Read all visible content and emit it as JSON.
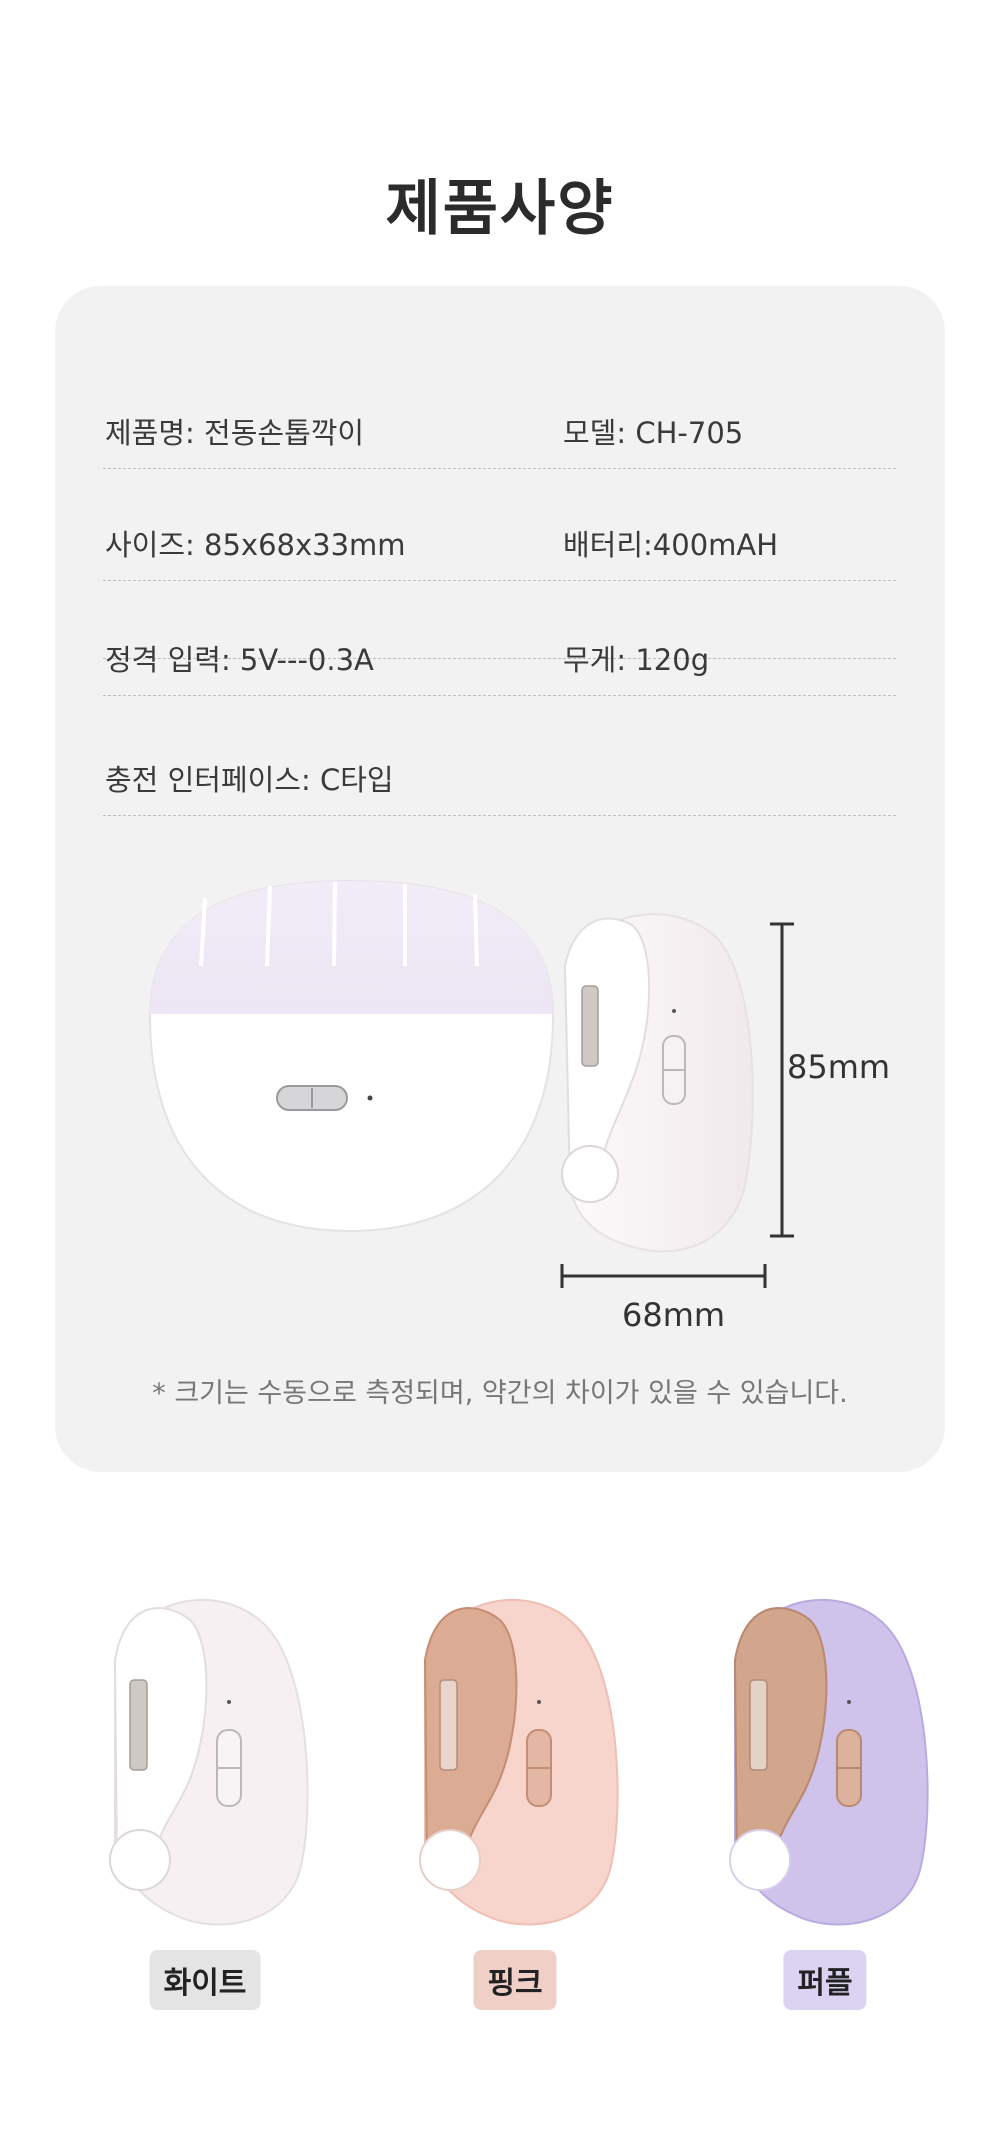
{
  "title": "제품사양",
  "specs": [
    {
      "left": "제품명: 전동손톱깍이",
      "right": "모델: CH-705"
    },
    {
      "left": "사이즈: 85x68x33mm",
      "right": "배터리:400mAH"
    },
    {
      "left": "정격 입력: 5V---0.3A",
      "right": "무게: 120g"
    },
    {
      "left": "충전 인터페이스: C타입",
      "right": ""
    }
  ],
  "dimensions": {
    "height": "85mm",
    "width": "68mm"
  },
  "note": "* 크기는 수동으로 측정되며, 약간의 차이가 있을 수 있습니다.",
  "colors": [
    {
      "label": "화이트",
      "body": "#f6f0f2",
      "accent": "#ffffff",
      "badge": "#e4e4e4"
    },
    {
      "label": "핑크",
      "body": "#f7d4cc",
      "accent": "#d7a48a",
      "badge": "#f0cfc7"
    },
    {
      "label": "퍼플",
      "body": "#cfc3ec",
      "accent": "#c99f88",
      "badge": "#dcd3f2"
    }
  ]
}
